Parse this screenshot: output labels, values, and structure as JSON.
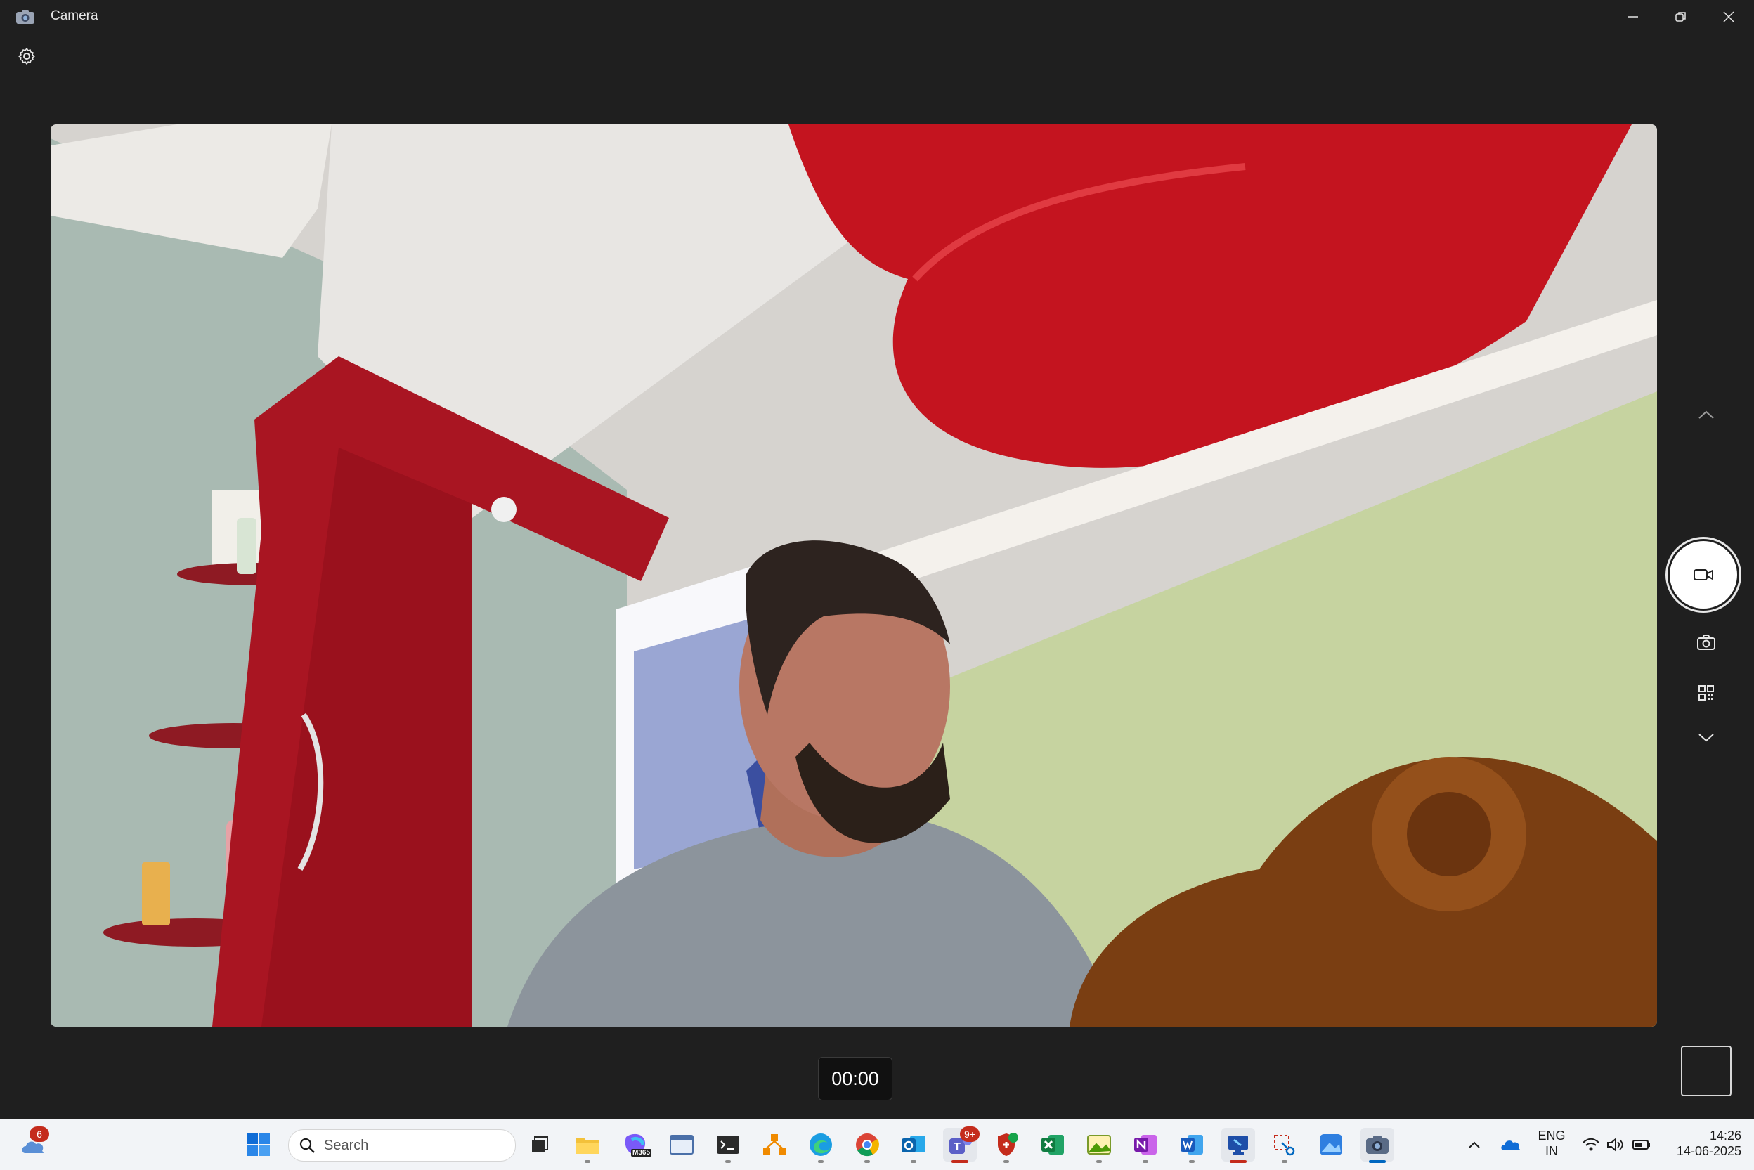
{
  "window": {
    "title": "Camera"
  },
  "camera": {
    "timer": "00:00"
  },
  "taskbar": {
    "weather_badge": "6",
    "search_placeholder": "Search",
    "teams_badge": "9+",
    "m365_label": "M365",
    "language_primary": "ENG",
    "language_secondary": "IN",
    "time": "14:26",
    "date": "14-06-2025"
  },
  "colors": {
    "window_bg": "#1f1f1f",
    "taskbar_bg": "#f2f4f7",
    "accent": "#0067c0",
    "badge_red": "#c42b1c"
  }
}
